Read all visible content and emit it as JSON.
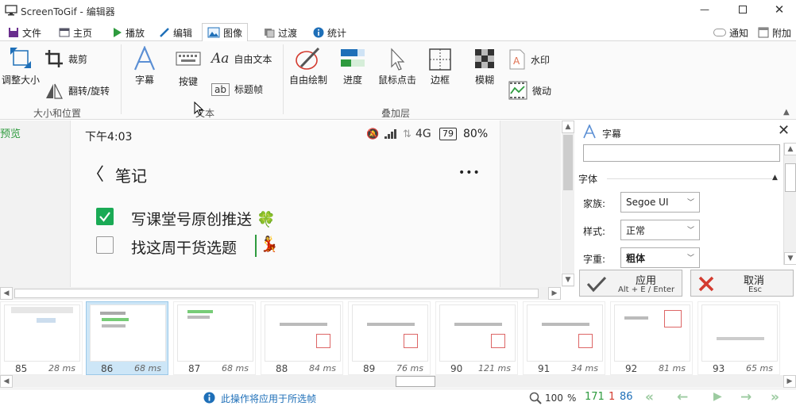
{
  "window": {
    "title": "ScreenToGif - 编辑器"
  },
  "tabs": [
    {
      "label": "文件"
    },
    {
      "label": "主页"
    },
    {
      "label": "播放"
    },
    {
      "label": "编辑"
    },
    {
      "label": "图像"
    },
    {
      "label": "过渡"
    },
    {
      "label": "统计"
    }
  ],
  "topright": {
    "notify": "通知",
    "attach": "附加"
  },
  "ribbon": {
    "resize": "调整大小",
    "crop": "裁剪",
    "flip": "翻转/旋转",
    "group_size": "大小和位置",
    "caption": "字幕",
    "keys": "按键",
    "free_text": "自由文本",
    "title_frame": "标题帧",
    "group_text": "文本",
    "free_draw": "自由绘制",
    "progress": "进度",
    "mouse_click": "鼠标点击",
    "border": "边框",
    "blur": "模糊",
    "watermark": "水印",
    "cinemagraph": "微动",
    "group_overlay": "叠加层"
  },
  "preview": {
    "label": "预览",
    "time": "下午4:03",
    "network": "4G",
    "battery_level": "79",
    "battery_pct": "80%",
    "note_title": "笔记",
    "more": "•••",
    "item1": "写课堂号原创推送 🍀",
    "item2": "找这周干货选题",
    "item2_emoji": "💃"
  },
  "panel": {
    "title": "字幕",
    "section_font": "字体",
    "family_label": "家族:",
    "family_value": "Segoe UI",
    "style_label": "样式:",
    "style_value": "正常",
    "weight_label": "字重:",
    "weight_value": "粗体",
    "apply_label": "应用",
    "apply_shortcut": "Alt + E / Enter",
    "cancel_label": "取消",
    "cancel_shortcut": "Esc"
  },
  "frames": [
    {
      "num": "85",
      "ms": "28 ms"
    },
    {
      "num": "86",
      "ms": "68 ms"
    },
    {
      "num": "87",
      "ms": "68 ms"
    },
    {
      "num": "88",
      "ms": "84 ms"
    },
    {
      "num": "89",
      "ms": "76 ms"
    },
    {
      "num": "90",
      "ms": "121 ms"
    },
    {
      "num": "91",
      "ms": "34 ms"
    },
    {
      "num": "92",
      "ms": "81 ms"
    },
    {
      "num": "93",
      "ms": "65 ms"
    }
  ],
  "status": {
    "message": "此操作将应用于所选帧",
    "zoom": "100",
    "zoom_unit": "%",
    "total_frames": "171",
    "selected_count": "1",
    "current_frame": "86"
  },
  "colors": {
    "accent": "#1e6fb8",
    "green": "#2e9b3e",
    "red": "#d33b2f",
    "nav": "#9ccba0"
  }
}
